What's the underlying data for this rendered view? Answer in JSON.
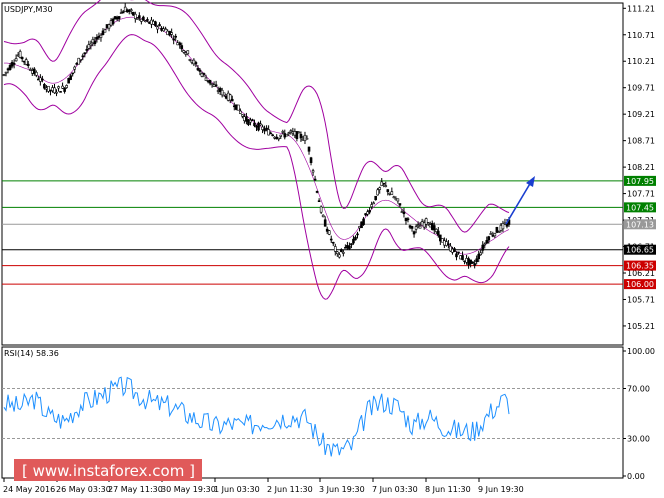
{
  "header": {
    "symbol_label": "USDJPY,M30",
    "rsi_label": "RSI(14) 58.36"
  },
  "watermark": {
    "text": "[ www.instaforex.com ]",
    "bg_color": "#e05a5a"
  },
  "colors": {
    "price_line": "#000000",
    "bollinger": "#a000a0",
    "rsi_line": "#1e90ff",
    "support_lines": "#cc0000",
    "resistance_lines": "#008000",
    "pivot_line": "#000000",
    "current_price_line": "#999999",
    "arrow": "#1a3fd0"
  },
  "price_axis": {
    "ticks": [
      "111.21",
      "110.71",
      "110.21",
      "109.71",
      "109.21",
      "108.71",
      "108.21",
      "107.71",
      "107.21",
      "106.71",
      "106.21",
      "105.71",
      "105.21"
    ],
    "levels": [
      {
        "value": "107.95",
        "kind": "resistance",
        "color": "#008000"
      },
      {
        "value": "107.45",
        "kind": "resistance",
        "color": "#008000"
      },
      {
        "value": "107.13",
        "kind": "current",
        "color": "#999999"
      },
      {
        "value": "106.65",
        "kind": "pivot",
        "color": "#000000"
      },
      {
        "value": "106.35",
        "kind": "support",
        "color": "#cc0000"
      },
      {
        "value": "106.00",
        "kind": "support",
        "color": "#cc0000"
      }
    ]
  },
  "rsi_axis": {
    "ticks": [
      "100.00",
      "70.00",
      "30.00",
      "0.00"
    ]
  },
  "time_axis": {
    "ticks": [
      "24 May 2016",
      "26 May 03:30",
      "27 May 11:30",
      "30 May 19:30",
      "1 Jun 03:30",
      "2 Jun 11:30",
      "3 Jun 19:30",
      "7 Jun 03:30",
      "8 Jun 11:30",
      "9 Jun 19:30"
    ]
  },
  "chart_data": {
    "type": "line",
    "series": [
      {
        "x": [
          0,
          3,
          6,
          9,
          12,
          15,
          18,
          21,
          24,
          27,
          30,
          33,
          36,
          39,
          42,
          45,
          48,
          51,
          54,
          57,
          60,
          63,
          66,
          69,
          72,
          75,
          78,
          81,
          84,
          87,
          90,
          93,
          96,
          99,
          100
        ],
        "values": [
          109.95,
          110.35,
          110.0,
          109.65,
          109.7,
          110.25,
          110.6,
          110.9,
          111.2,
          111.0,
          110.9,
          110.75,
          110.4,
          110.0,
          109.7,
          109.5,
          109.1,
          108.95,
          108.8,
          108.85,
          108.75,
          107.3,
          106.55,
          106.75,
          107.35,
          107.9,
          107.55,
          107.0,
          107.2,
          106.8,
          106.55,
          106.35,
          106.9,
          107.1,
          107.15
        ]
      },
      {
        "x": [
          0,
          3,
          6,
          9,
          12,
          15,
          18,
          21,
          24,
          27,
          30,
          33,
          36,
          39,
          42,
          45,
          48,
          51,
          54,
          57,
          60,
          63,
          66,
          69,
          72,
          75,
          78,
          81,
          84,
          87,
          90,
          93,
          96,
          99,
          100
        ],
        "values": [
          58,
          55,
          62,
          48,
          44,
          57,
          62,
          68,
          72,
          64,
          58,
          56,
          50,
          44,
          40,
          42,
          40,
          44,
          46,
          48,
          46,
          26,
          20,
          24,
          52,
          60,
          56,
          40,
          48,
          40,
          36,
          36,
          50,
          62,
          58
        ]
      }
    ],
    "ylim": [
      104.85,
      111.31
    ],
    "rsi_ylim": [
      0,
      100
    ],
    "rsi_levels": [
      70,
      30
    ],
    "arrow_direction": "up"
  }
}
